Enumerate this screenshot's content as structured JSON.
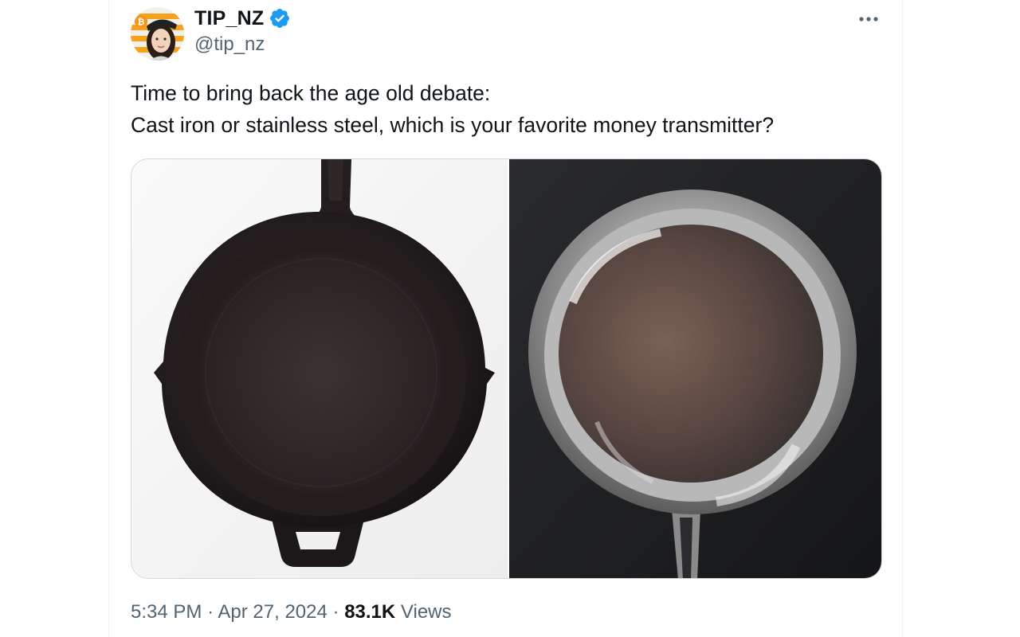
{
  "tweet": {
    "author": {
      "display_name": "TIP_NZ",
      "handle": "@tip_nz",
      "verified": true,
      "avatar_icon": "profile-avatar"
    },
    "more_icon": "more-horizontal-icon",
    "text_lines": [
      "Time to bring back the age old debate:",
      "Cast iron or stainless steel, which is your favorite money transmitter?"
    ],
    "media": [
      {
        "name": "cast-iron-skillet-photo"
      },
      {
        "name": "stainless-steel-pan-photo"
      }
    ],
    "meta": {
      "time": "5:34 PM",
      "separator": "·",
      "date": "Apr 27, 2024",
      "views_count": "83.1K",
      "views_label": "Views"
    }
  },
  "colors": {
    "verified_blue": "#1d9bf0",
    "secondary_text": "#536471",
    "primary_text": "#0f1419",
    "border": "#cfd9de"
  }
}
